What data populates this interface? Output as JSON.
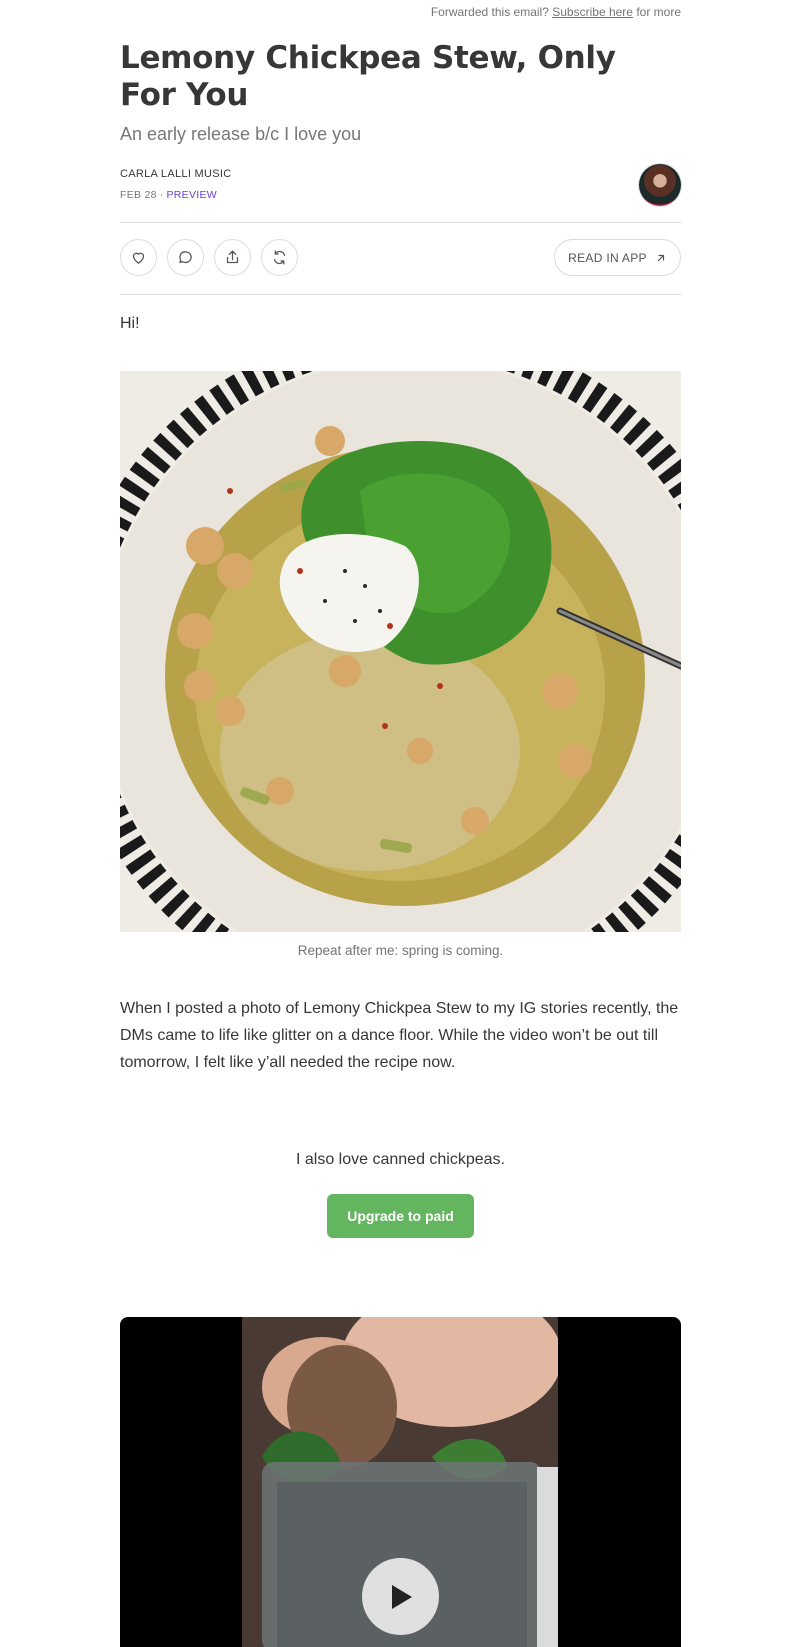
{
  "header": {
    "forward_prefix": "Forwarded this email?",
    "subscribe_link": "Subscribe here",
    "forward_suffix": "for more"
  },
  "post": {
    "title": "Lemony Chickpea Stew, Only For You",
    "subtitle": "An early release b/c I love you",
    "publication": "CARLA LALLI MUSIC",
    "date": "FEB 28",
    "separator": "∙",
    "badge": "PREVIEW"
  },
  "actions": {
    "icons": [
      "heart-icon",
      "comment-icon",
      "share-icon",
      "restack-icon"
    ],
    "read_in_app": "READ IN APP"
  },
  "body": {
    "greeting": "Hi!",
    "image_caption": "Repeat after me: spring is coming.",
    "paragraph": "When I posted a photo of Lemony Chickpea Stew to my IG stories recently, the DMs came to life like glitter on a dance floor. While the video won’t be out till tomorrow, I felt like y’all needed the recipe now.",
    "cta_text": "I also love canned chickpeas.",
    "cta_button": "Upgrade to paid"
  },
  "colors": {
    "text": "#363737",
    "muted": "#777777",
    "preview": "#6b3fd6",
    "cta": "#63b560"
  }
}
